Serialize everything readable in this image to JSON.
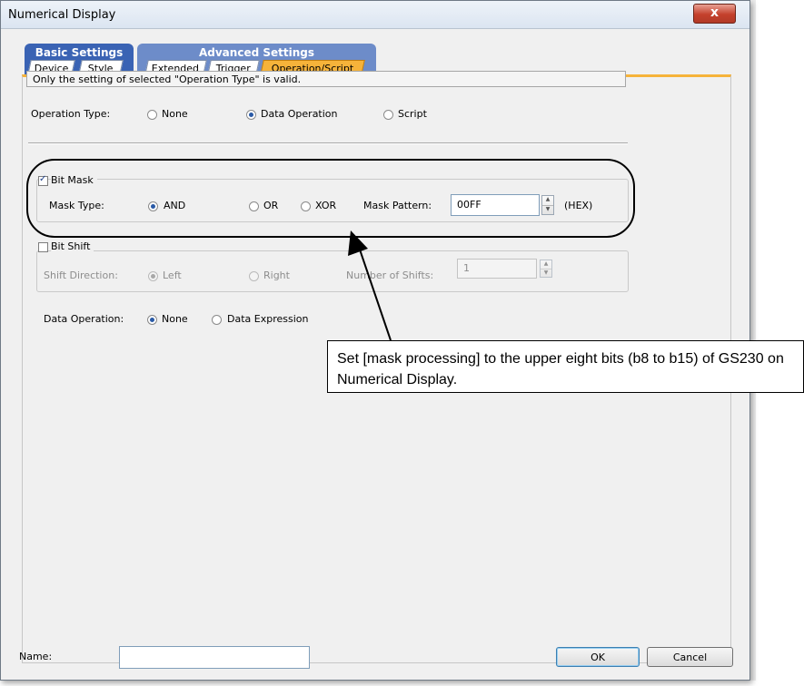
{
  "window": {
    "title": "Numerical Display",
    "close_label": "x"
  },
  "tab_groups": {
    "basic": {
      "label": "Basic Settings",
      "tabs": [
        "Device",
        "Style"
      ]
    },
    "advanced": {
      "label": "Advanced Settings",
      "tabs": [
        "Extended",
        "Trigger",
        "Operation/Script"
      ]
    }
  },
  "active_tab": "Operation/Script",
  "info_text": "Only the setting of selected  \"Operation Type\" is valid.",
  "operation_type": {
    "label": "Operation Type:",
    "options": [
      "None",
      "Data Operation",
      "Script"
    ],
    "selected": "Data Operation"
  },
  "bit_mask": {
    "label": "Bit Mask",
    "checked": true,
    "mask_type_label": "Mask Type:",
    "mask_options": [
      "AND",
      "OR",
      "XOR"
    ],
    "mask_selected": "AND",
    "mask_pattern_label": "Mask Pattern:",
    "mask_pattern_value": "00FF",
    "hex_label": "(HEX)"
  },
  "bit_shift": {
    "label": "Bit Shift",
    "checked": false,
    "direction_label": "Shift Direction:",
    "direction_options": [
      "Left",
      "Right"
    ],
    "direction_selected": "Left",
    "shifts_label": "Number of Shifts:",
    "shifts_value": "1"
  },
  "data_operation": {
    "label": "Data Operation:",
    "options": [
      "None",
      "Data Expression"
    ],
    "selected": "None"
  },
  "callout_text": "Set [mask processing] to the upper eight bits (b8 to b15) of GS230 on Numerical Display.",
  "footer": {
    "name_label": "Name:",
    "name_value": "",
    "ok_label": "OK",
    "cancel_label": "Cancel"
  }
}
